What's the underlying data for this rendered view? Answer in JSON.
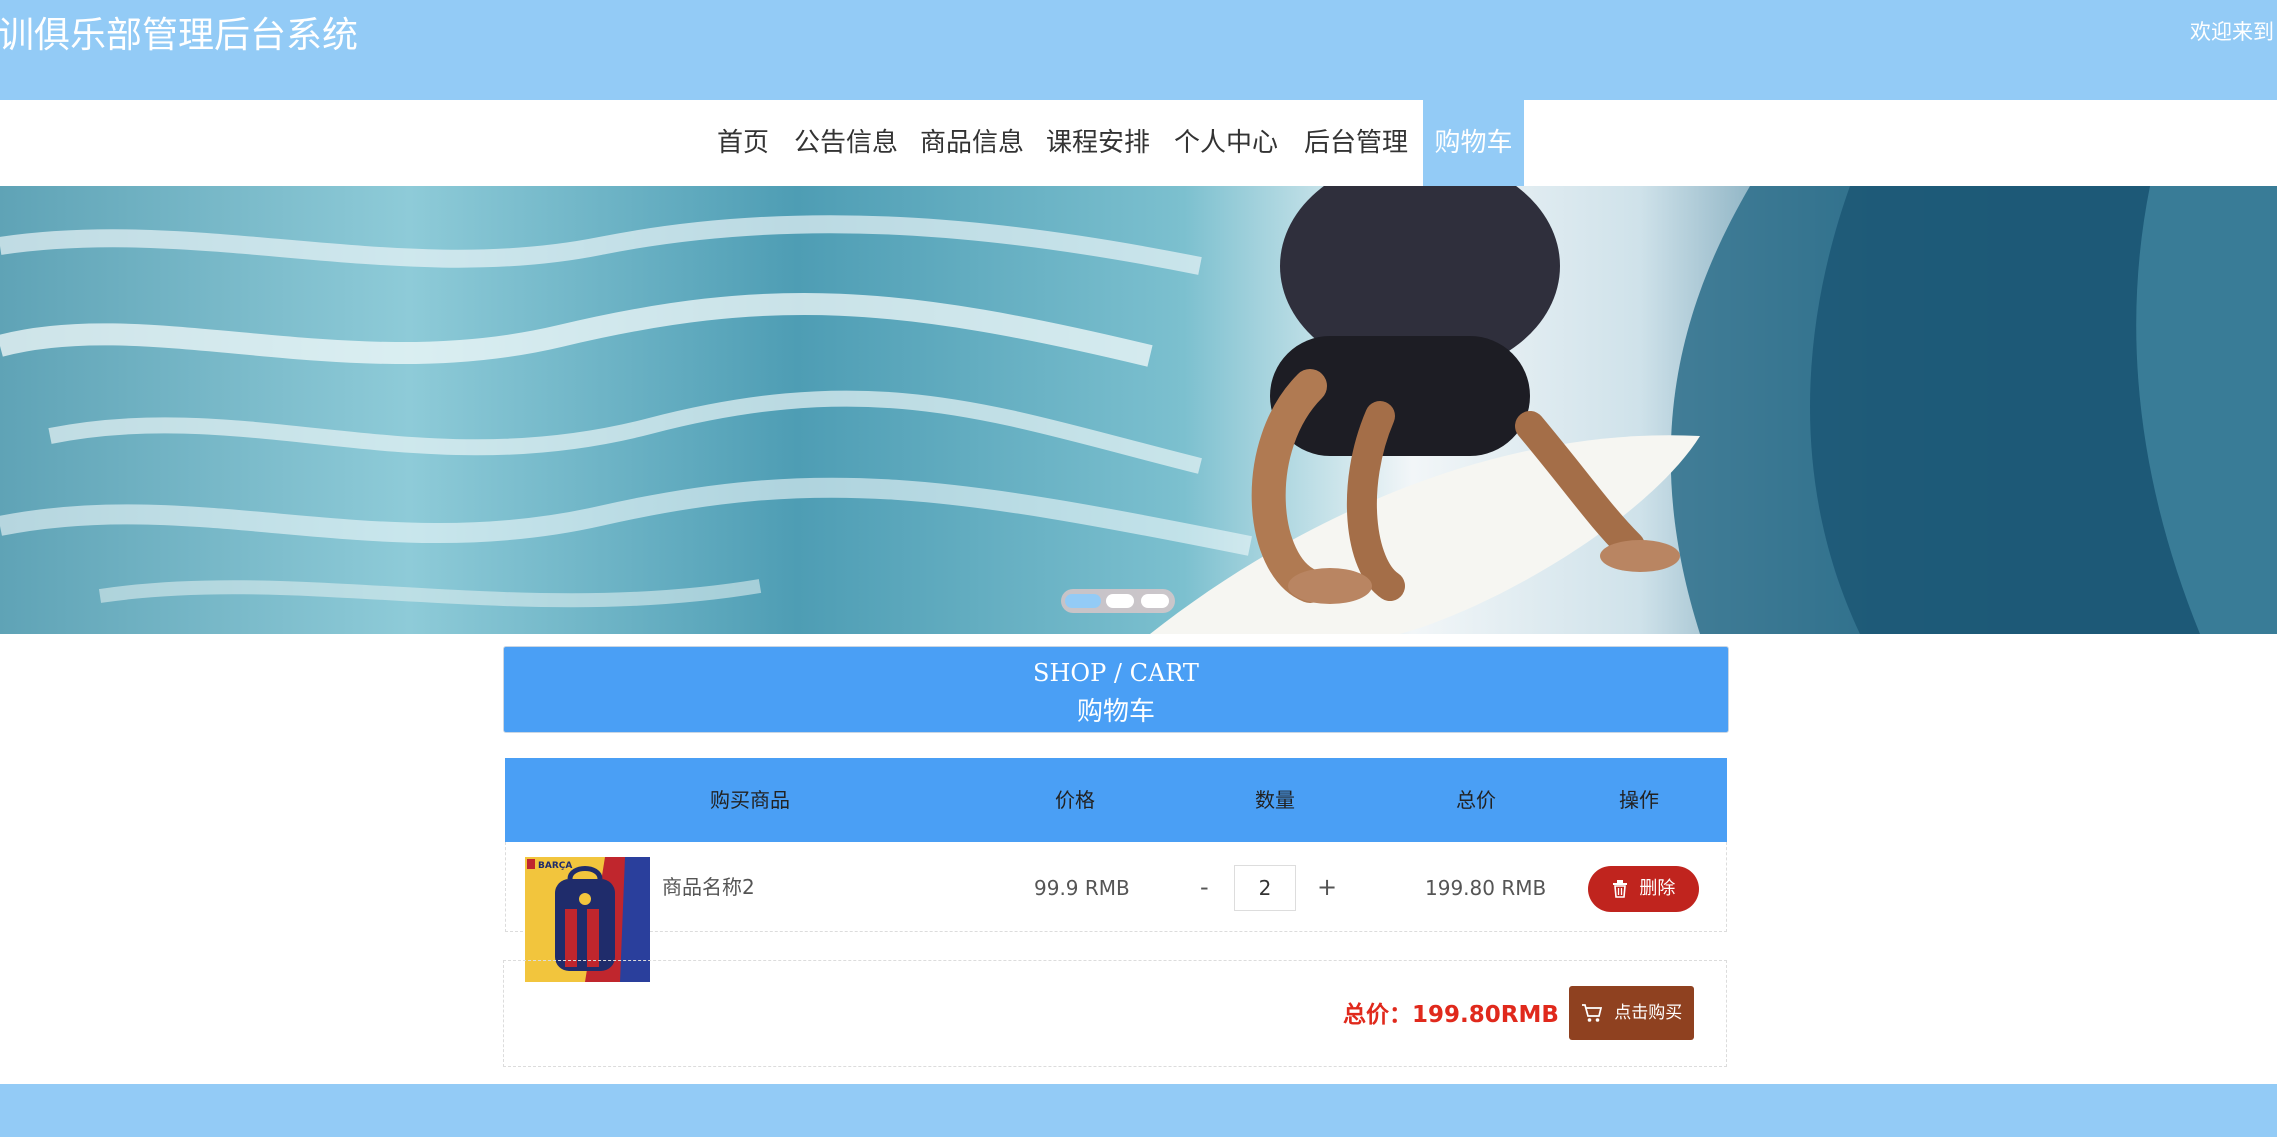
{
  "header": {
    "title": "训俱乐部管理后台系统",
    "welcome": "欢迎来到"
  },
  "nav": {
    "items": [
      "首页",
      "公告信息",
      "商品信息",
      "课程安排",
      "个人中心",
      "后台管理",
      "购物车"
    ],
    "active": "购物车"
  },
  "banner": {
    "slide_count": 3,
    "active_slide": 1
  },
  "cart": {
    "heading_en": "SHOP / CART",
    "heading_cn": "购物车",
    "columns": [
      "购买商品",
      "价格",
      "数量",
      "总价",
      "操作"
    ],
    "items": [
      {
        "name": "商品名称2",
        "price": "99.9 RMB",
        "minus": "-",
        "quantity": "2",
        "plus": "+",
        "subtotal": "199.80 RMB",
        "delete_label": "删除",
        "thumb_brand": "BARÇA"
      }
    ],
    "total_label": "总价：199.80RMB",
    "buy_label": "点击购买"
  },
  "colors": {
    "header_bg": "#93cbf6",
    "table_head": "#4a9ff5",
    "delete_button": "#c0241e",
    "buy_button": "#8f4120",
    "total_text": "#e0291c"
  },
  "icons": {
    "delete": "trash-icon",
    "buy": "cart-icon"
  }
}
